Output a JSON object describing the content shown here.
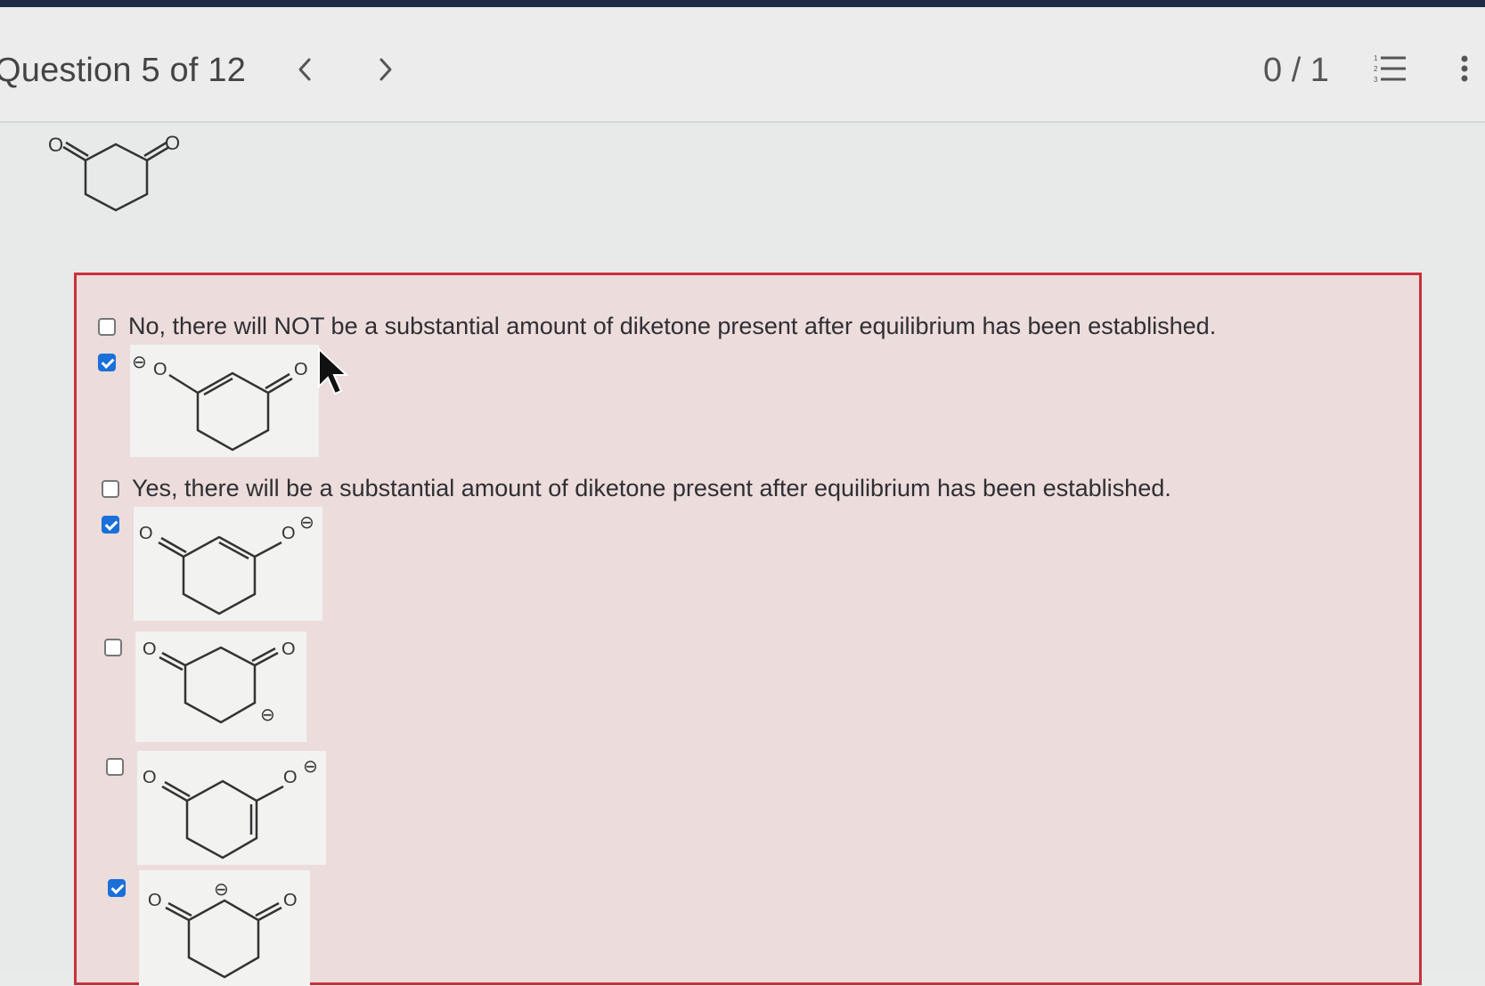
{
  "header": {
    "question_label": "Question 5 of 12",
    "score": "0 / 1",
    "prev_icon": "chevron-left-icon",
    "next_icon": "chevron-right-icon",
    "list_icon": "numbered-list-icon",
    "more_icon": "more-vertical-icon"
  },
  "question": {
    "molecule": "cyclohexane-1,3-dione",
    "atom_labels": [
      "O",
      "O"
    ]
  },
  "options": [
    {
      "label": "No, there will NOT be a substantial amount of diketone present after equilibrium has been established.",
      "checked": false
    },
    {
      "label": "",
      "checked": true,
      "structure_labels": [
        "⊖",
        "O",
        "O"
      ]
    },
    {
      "label": "Yes, there will be a substantial amount of diketone present after equilibrium has been established.",
      "checked": false
    },
    {
      "label": "",
      "checked": true,
      "structure_labels": [
        "O",
        "O",
        "⊖"
      ]
    },
    {
      "label": "",
      "checked": false,
      "structure_labels": [
        "O",
        "O",
        "⊖"
      ]
    },
    {
      "label": "",
      "checked": false,
      "structure_labels": [
        "O",
        "O",
        "⊖"
      ]
    },
    {
      "label": "",
      "checked": true,
      "structure_labels": [
        "O",
        "⊖",
        "O"
      ]
    }
  ],
  "colors": {
    "accent_blue": "#1a6fd9",
    "incorrect_border": "#c8313c",
    "incorrect_bg": "#ecdcdb",
    "topbar": "#1d2a44"
  }
}
